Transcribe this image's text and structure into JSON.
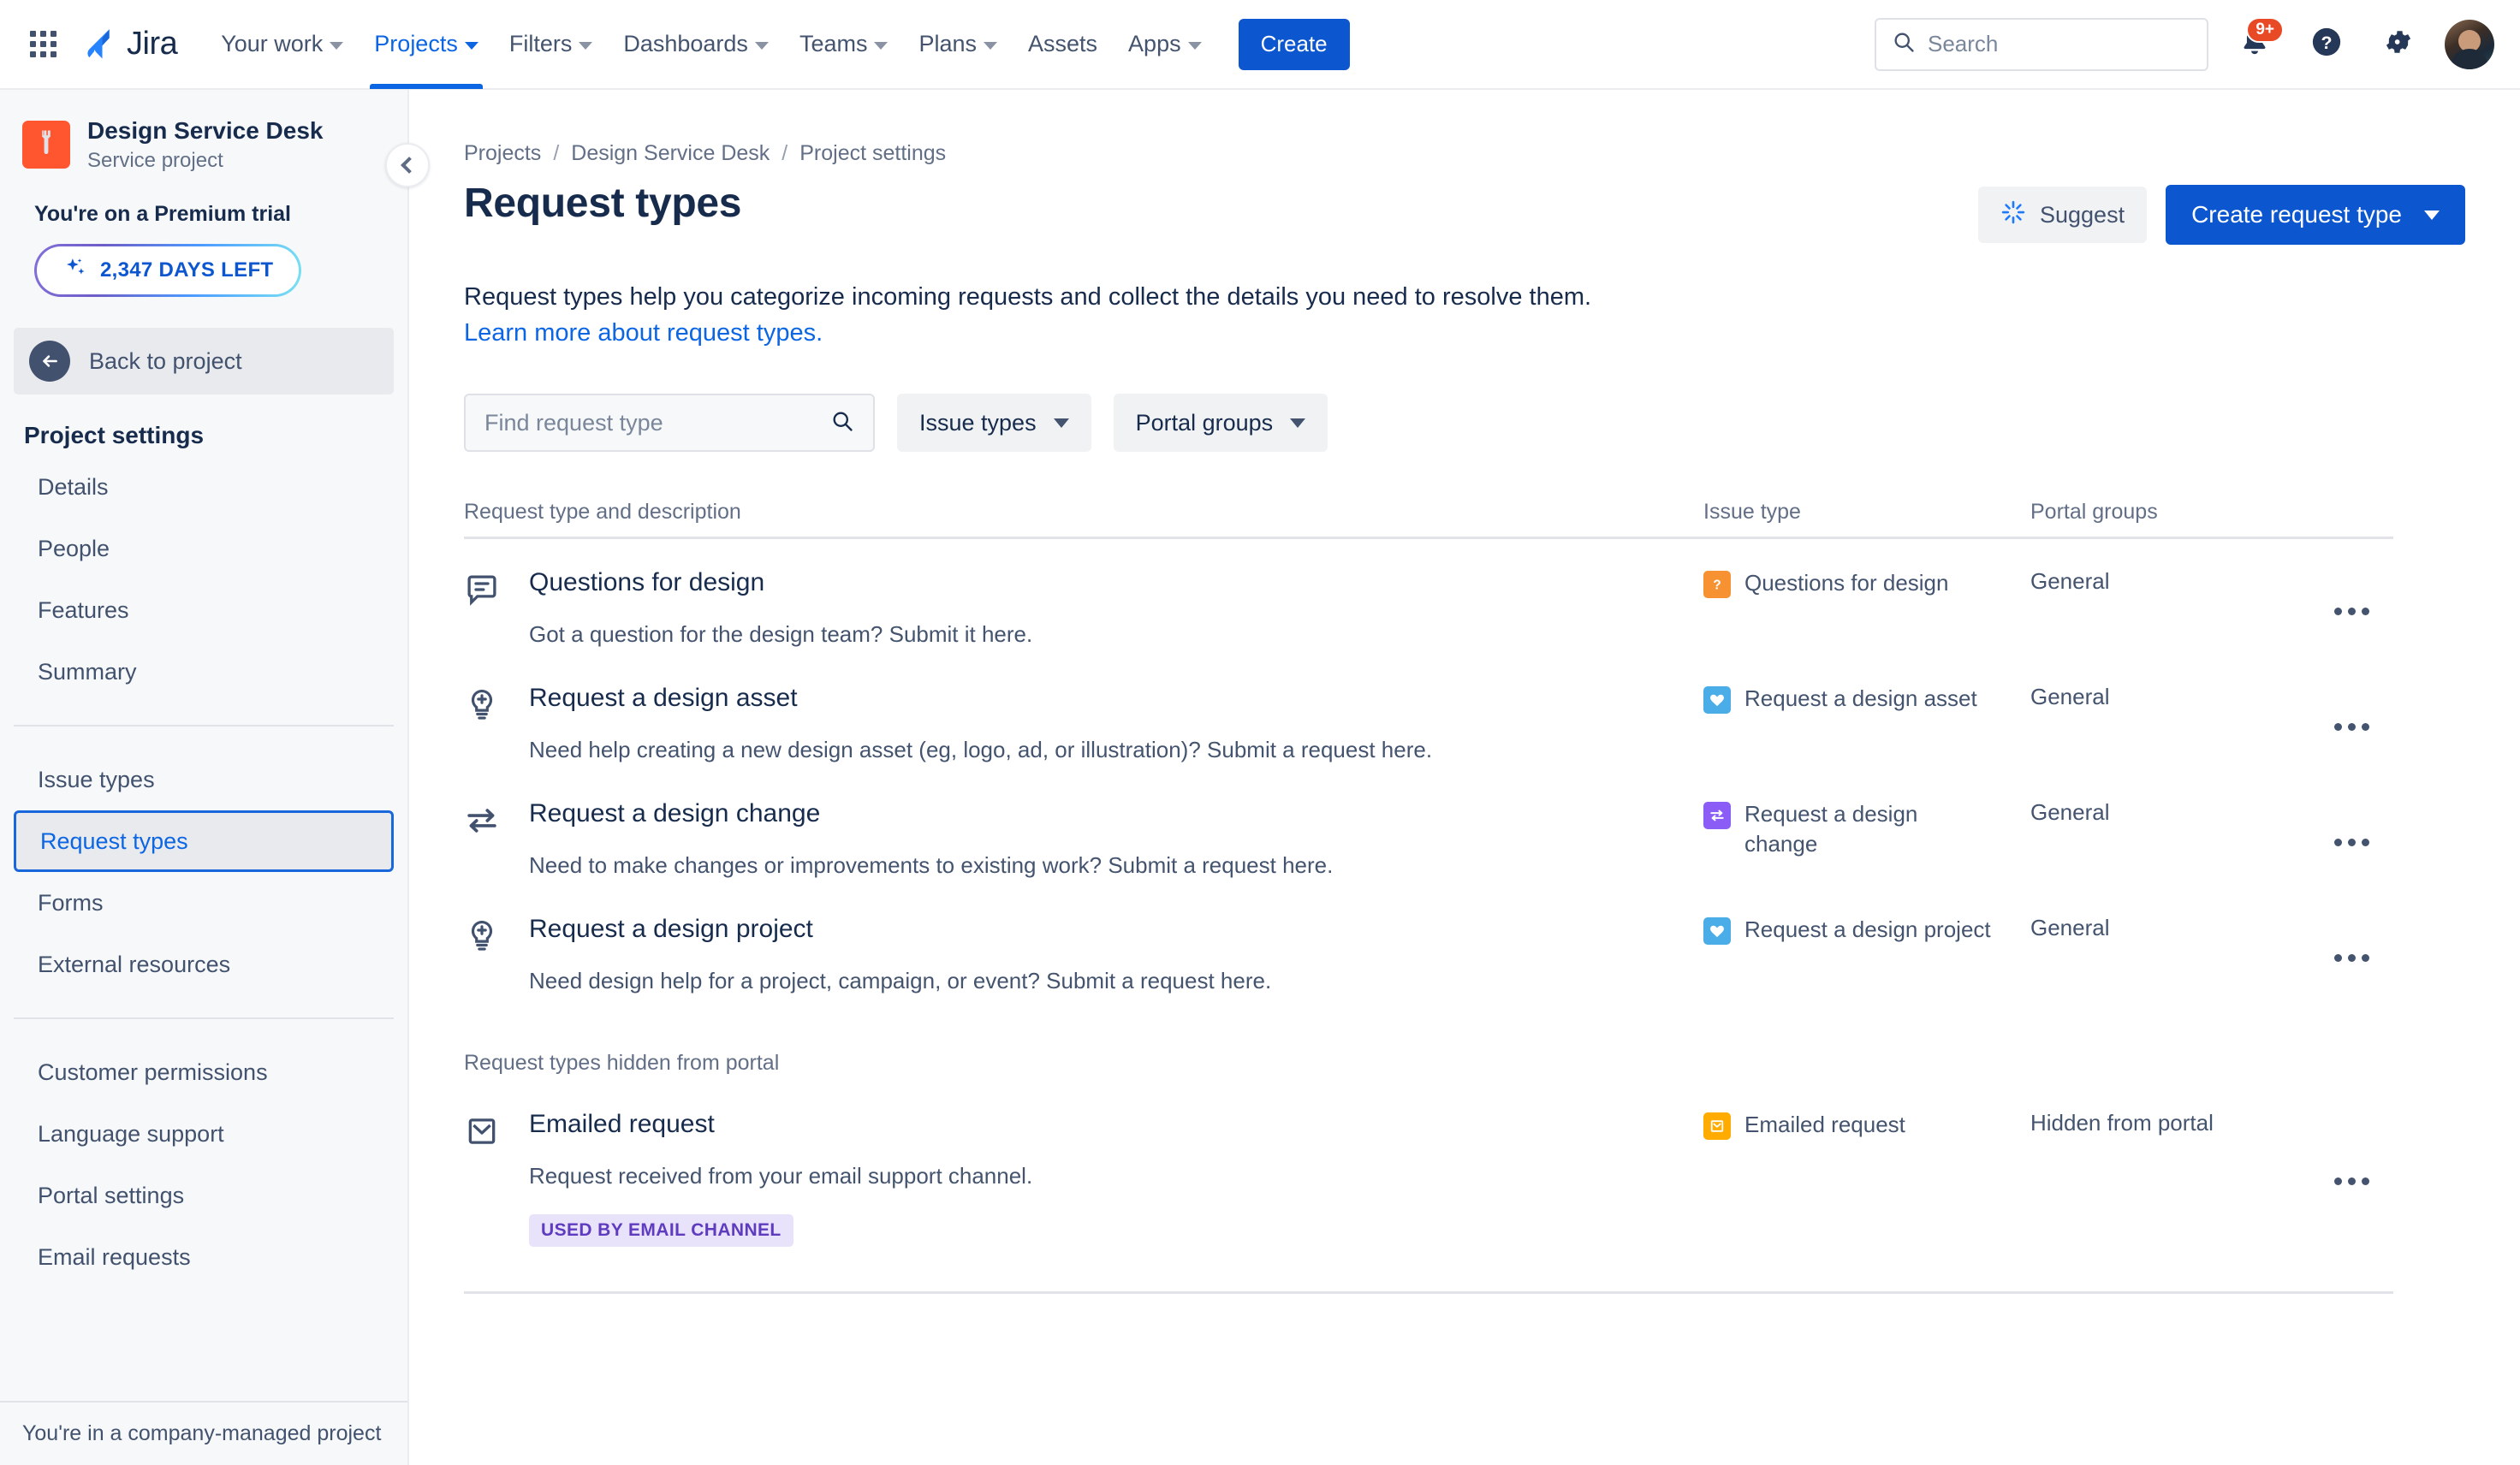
{
  "topnav": {
    "app_switcher_icon": "grid-apps-icon",
    "brand": "Jira",
    "items": [
      {
        "label": "Your work",
        "has_caret": true,
        "active": false
      },
      {
        "label": "Projects",
        "has_caret": true,
        "active": true
      },
      {
        "label": "Filters",
        "has_caret": true,
        "active": false
      },
      {
        "label": "Dashboards",
        "has_caret": true,
        "active": false
      },
      {
        "label": "Teams",
        "has_caret": true,
        "active": false
      },
      {
        "label": "Plans",
        "has_caret": true,
        "active": false
      },
      {
        "label": "Assets",
        "has_caret": false,
        "active": false
      },
      {
        "label": "Apps",
        "has_caret": true,
        "active": false
      }
    ],
    "create_label": "Create",
    "search_placeholder": "Search",
    "search_value": "",
    "notification_badge": "9+",
    "icons": {
      "search": "search-icon",
      "notifications": "notification-bell-icon",
      "help": "help-question-icon",
      "settings": "gear-icon",
      "profile": "user-avatar"
    }
  },
  "sidebar": {
    "project_name": "Design Service Desk",
    "project_subtitle": "Service project",
    "project_avatar_icon": "wrench-icon",
    "trial_title": "You're on a Premium trial",
    "trial_pill_label": "2,347 DAYS LEFT",
    "trial_pill_icon": "sparkle-icon",
    "back_label": "Back to project",
    "back_icon": "arrow-left-icon",
    "section_title": "Project settings",
    "group1": [
      "Details",
      "People",
      "Features",
      "Summary"
    ],
    "group2": [
      "Issue types",
      "Request types",
      "Forms",
      "External resources"
    ],
    "group3": [
      "Customer permissions",
      "Language support",
      "Portal settings",
      "Email requests"
    ],
    "selected": "Request types",
    "footer": "You're in a company-managed project",
    "collapse_icon": "chevron-left-icon"
  },
  "main": {
    "breadcrumbs": [
      "Projects",
      "Design Service Desk",
      "Project settings"
    ],
    "breadcrumb_sep": "/",
    "page_title": "Request types",
    "suggest_label": "Suggest",
    "suggest_icon": "ai-sparkle-icon",
    "create_request_type_label": "Create request type",
    "description": "Request types help you categorize incoming requests and collect the details you need to resolve them.",
    "learn_more": "Learn more about request types.",
    "find_placeholder": "Find request type",
    "find_value": "",
    "find_icon": "search-icon",
    "filters": [
      {
        "label": "Issue types",
        "name": "issue-types-filter"
      },
      {
        "label": "Portal groups",
        "name": "portal-groups-filter"
      }
    ],
    "columns": {
      "main": "Request type and description",
      "issue": "Issue type",
      "portal": "Portal groups"
    },
    "hidden_group_label": "Request types hidden from portal",
    "rows": [
      {
        "name": "Questions for design",
        "description": "Got a question for the design team? Submit it here.",
        "icon": "comment-bubble-icon",
        "issue_type": "Questions for design",
        "issue_icon": "question-square-icon",
        "issue_color": "#F79232",
        "portal_group": "General",
        "badge": ""
      },
      {
        "name": "Request a design asset",
        "description": "Need help creating a new design asset (eg, logo, ad, or illustration)? Submit a request here.",
        "icon": "lightbulb-plus-icon",
        "issue_type": "Request a design asset",
        "issue_icon": "heart-square-icon",
        "issue_color": "#4BADE8",
        "portal_group": "General",
        "badge": ""
      },
      {
        "name": "Request a design change",
        "description": "Need to make changes or improvements to existing work? Submit a request here.",
        "icon": "swap-arrows-icon",
        "issue_type": "Request a design change",
        "issue_icon": "swap-square-icon",
        "issue_color": "#8B5CF6",
        "portal_group": "General",
        "badge": ""
      },
      {
        "name": "Request a design project",
        "description": "Need design help for a project, campaign, or event? Submit a request here.",
        "icon": "lightbulb-plus-icon",
        "issue_type": "Request a design project",
        "issue_icon": "heart-square-icon",
        "issue_color": "#4BADE8",
        "portal_group": "General",
        "badge": ""
      }
    ],
    "hidden_rows": [
      {
        "name": "Emailed request",
        "description": "Request received from your email support channel.",
        "icon": "envelope-icon",
        "issue_type": "Emailed request",
        "issue_icon": "envelope-square-icon",
        "issue_color": "#FFAB00",
        "portal_group": "Hidden from portal",
        "badge": "USED BY EMAIL CHANNEL"
      }
    ],
    "row_menu_icon": "more-actions-icon"
  },
  "colors": {
    "accent_blue": "#0C66E4",
    "primary_button": "#0C56D0",
    "text": "#172B4D",
    "subtle_text": "#626F86",
    "project_avatar": "#FF5630",
    "badge_bg": "#E9E2FB",
    "badge_text": "#5E3BBF"
  }
}
